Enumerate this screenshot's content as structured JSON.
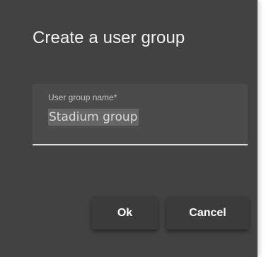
{
  "dialog": {
    "title": "Create a user group",
    "field": {
      "label": "User group name*",
      "value": "Stadium group"
    },
    "actions": {
      "ok_label": "Ok",
      "cancel_label": "Cancel"
    }
  }
}
